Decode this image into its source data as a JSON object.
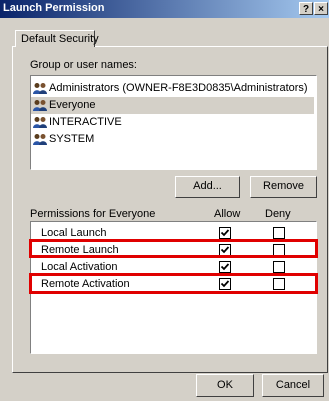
{
  "window": {
    "title": "Launch Permission",
    "help_button": "?",
    "close_button": "×"
  },
  "tabs": [
    {
      "label": "Default Security"
    }
  ],
  "users": {
    "label": "Group or user names:",
    "items": [
      {
        "name": "Administrators (OWNER-F8E3D0835\\Administrators)",
        "icon": "user-group-icon",
        "selected": false
      },
      {
        "name": "Everyone",
        "icon": "user-group-icon",
        "selected": true
      },
      {
        "name": "INTERACTIVE",
        "icon": "user-group-icon",
        "selected": false
      },
      {
        "name": "SYSTEM",
        "icon": "user-group-icon",
        "selected": false
      }
    ],
    "add_button": "Add...",
    "remove_button": "Remove"
  },
  "permissions": {
    "label": "Permissions for Everyone",
    "allow_header": "Allow",
    "deny_header": "Deny",
    "items": [
      {
        "name": "Local Launch",
        "allow": true,
        "deny": false,
        "highlighted": false
      },
      {
        "name": "Remote Launch",
        "allow": true,
        "deny": false,
        "highlighted": true
      },
      {
        "name": "Local Activation",
        "allow": true,
        "deny": false,
        "highlighted": false
      },
      {
        "name": "Remote Activation",
        "allow": true,
        "deny": false,
        "highlighted": true
      }
    ]
  },
  "footer": {
    "ok_button": "OK",
    "cancel_button": "Cancel"
  },
  "colors": {
    "highlight": "#e00000",
    "titlebar_start": "#0a246a",
    "titlebar_end": "#a6caf0",
    "dialog_bg": "#d4d0c8"
  }
}
